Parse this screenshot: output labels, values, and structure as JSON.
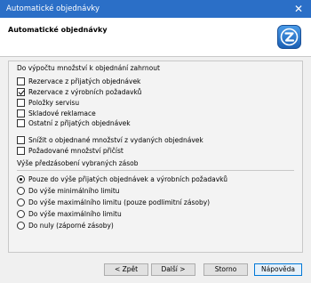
{
  "window": {
    "title": "Automatické objednávky"
  },
  "header": {
    "title": "Automatické objednávky",
    "logo_icon": "app-logo-icon",
    "accent": "#2b6fc7"
  },
  "section1": {
    "label": "Do výpočtu množství k objednání zahrnout",
    "items": [
      {
        "label": "Rezervace z přijatých objednávek",
        "checked": false
      },
      {
        "label": "Rezervace z výrobních požadavků",
        "checked": true
      },
      {
        "label": "Položky servisu",
        "checked": false
      },
      {
        "label": "Skladové reklamace",
        "checked": false
      },
      {
        "label": "Ostatní z přijatých objednávek",
        "checked": false
      }
    ],
    "items2": [
      {
        "label": "Snížit o objednané množství z vydaných objednávek",
        "checked": false
      },
      {
        "label": "Požadované množství přičíst",
        "checked": false
      }
    ]
  },
  "section2": {
    "label": "Výše předzásobení vybraných zásob",
    "options": [
      {
        "label": "Pouze do výše přijatých objednávek a výrobních požadavků",
        "selected": true
      },
      {
        "label": "Do výše minimálního limitu",
        "selected": false
      },
      {
        "label": "Do výše maximálního limitu (pouze podlimitní zásoby)",
        "selected": false
      },
      {
        "label": "Do výše maximálního limitu",
        "selected": false
      },
      {
        "label": "Do nuly (záporné zásoby)",
        "selected": false
      }
    ]
  },
  "buttons": {
    "back": "< Zpět",
    "next": "Další >",
    "cancel": "Storno",
    "help": "Nápověda"
  }
}
